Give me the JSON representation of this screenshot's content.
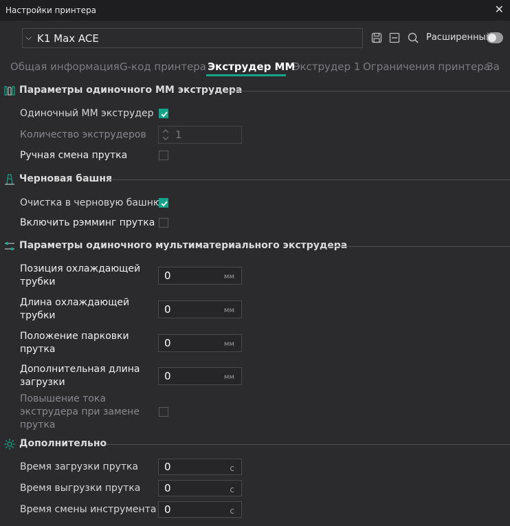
{
  "window": {
    "title": "Настройки принтера",
    "close_glyph": "✕"
  },
  "printer": {
    "selected": "K1 Max ACE",
    "chevron_glyph": "⌵"
  },
  "toolbar": {
    "advanced_label": "Расширенный",
    "advanced_enabled": false
  },
  "tabs": [
    {
      "label": "Общая информация",
      "active": false
    },
    {
      "label": "G-код принтера",
      "active": false
    },
    {
      "label": "Экструдер MM",
      "active": true
    },
    {
      "label": "Экструдер 1",
      "active": false
    },
    {
      "label": "Ограничения принтера",
      "active": false
    },
    {
      "label": "За",
      "active": false
    }
  ],
  "sections": {
    "single_mm": {
      "title": "Параметры одиночного ММ экструдера",
      "single_mm_extruder": {
        "label": "Одиночный ММ экструдер",
        "checked": true
      },
      "extruder_count": {
        "label": "Количество экструдеров",
        "value": "1"
      },
      "manual_filament_change": {
        "label": "Ручная смена прутка",
        "checked": false
      }
    },
    "wipe_tower": {
      "title": "Черновая башня",
      "purge_in_tower": {
        "label": "Очистка в черновую башню",
        "checked": true
      },
      "enable_ramming": {
        "label": "Включить рэмминг прутка",
        "checked": false
      }
    },
    "single_multimaterial": {
      "title": "Параметры одиночного мультиматериального экструдера",
      "cooling_tube_position": {
        "label_line1": "Позиция охлаждающей",
        "label_line2": "трубки",
        "value": "0",
        "unit": "мм"
      },
      "cooling_tube_length": {
        "label_line1": "Длина охлаждающей",
        "label_line2": "трубки",
        "value": "0",
        "unit": "мм"
      },
      "parking_position": {
        "label_line1": "Положение парковки",
        "label_line2": "прутка",
        "value": "0",
        "unit": "мм"
      },
      "extra_loading_length": {
        "label_line1": "Дополнительная длина",
        "label_line2": "загрузки",
        "value": "0",
        "unit": "мм"
      },
      "high_current_on_change": {
        "label_line1": "Повышение тока",
        "label_line2": "экструдера при замене",
        "label_line3": "прутка",
        "checked": false
      }
    },
    "advanced": {
      "title": "Дополнительно",
      "load_time": {
        "label": "Время загрузки прутка",
        "value": "0",
        "unit": "с"
      },
      "unload_time": {
        "label": "Время выгрузки прутка",
        "value": "0",
        "unit": "с"
      },
      "tool_change_time": {
        "label": "Время смены инструмента",
        "value": "0",
        "unit": "с"
      }
    }
  },
  "colors": {
    "accent": "#14a888",
    "background": "#2b2b2e",
    "titlebar": "#1e1e20"
  }
}
